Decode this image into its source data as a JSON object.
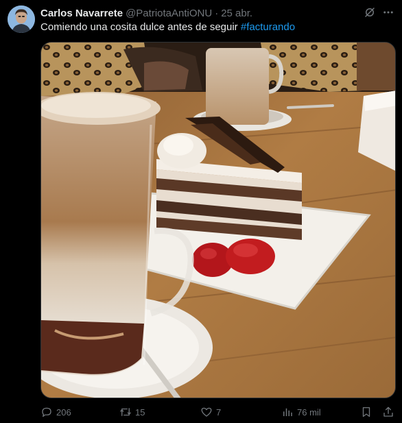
{
  "post": {
    "author_name": "Carlos Navarrete",
    "author_handle": "@PatriotaAntiONU",
    "separator": "·",
    "timestamp": "25 abr.",
    "text": "Comiendo una cosita dulce antes de seguir ",
    "hashtag": "#facturando",
    "media_alt": "Café con leche en vaso y porción de torta selva negra con frutillas",
    "grok_icon": "grok-icon",
    "more_icon": "more-icon"
  },
  "actions": {
    "replies": "206",
    "reposts": "15",
    "likes": "7",
    "views": "76 mil"
  },
  "colors": {
    "background": "#000000",
    "text_primary": "#e7e9ea",
    "text_secondary": "#71767b",
    "link": "#1d9bf0",
    "border": "#2f3336"
  }
}
